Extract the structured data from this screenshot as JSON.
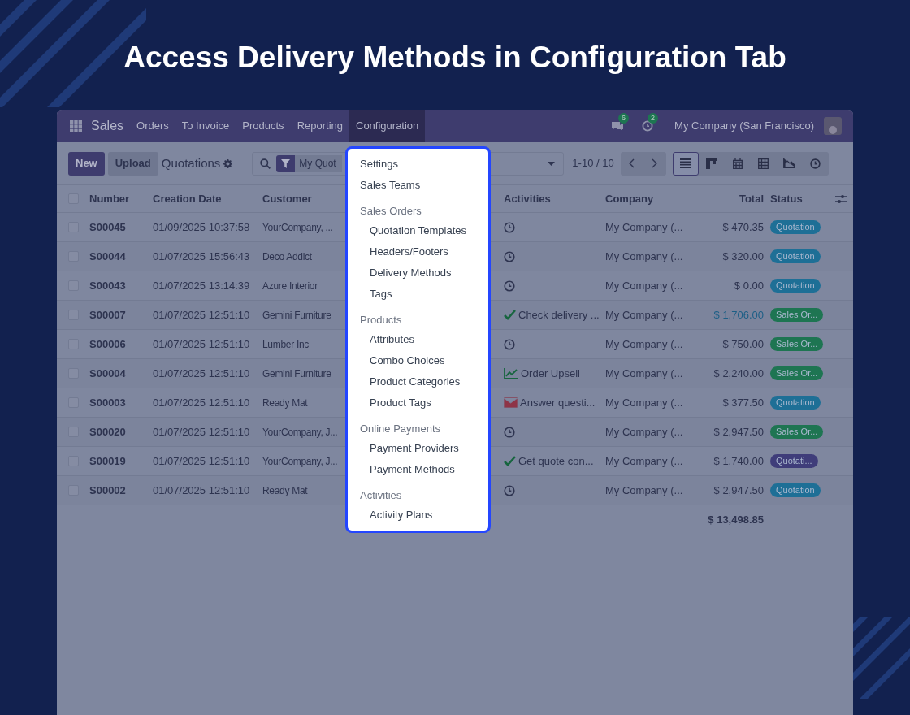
{
  "heading": "Access Delivery Methods in Configuration Tab",
  "navbar": {
    "app": "Sales",
    "items": [
      {
        "label": "Orders",
        "selected": false
      },
      {
        "label": "To Invoice",
        "selected": false
      },
      {
        "label": "Products",
        "selected": false
      },
      {
        "label": "Reporting",
        "selected": false
      },
      {
        "label": "Configuration",
        "selected": true
      }
    ],
    "messages_count": "6",
    "activities_count": "2",
    "company": "My Company (San Francisco)"
  },
  "control_panel": {
    "new": "New",
    "upload": "Upload",
    "title": "Quotations",
    "facet": "My Quot",
    "pager": "1-10 / 10",
    "views": [
      {
        "kind": "list",
        "selected": true
      },
      {
        "kind": "kanban",
        "selected": false
      },
      {
        "kind": "calendar",
        "selected": false
      },
      {
        "kind": "pivot",
        "selected": false
      },
      {
        "kind": "graph",
        "selected": false
      },
      {
        "kind": "activity",
        "selected": false
      }
    ]
  },
  "table": {
    "all_checked": false,
    "columns": [
      "Number",
      "Creation Date",
      "Customer",
      "Activities",
      "Company",
      "Total",
      "Status"
    ],
    "rows": [
      {
        "checked": false,
        "number": "S00045",
        "date": "01/09/2025 10:37:58",
        "customer": "YourCompany, ...",
        "activity": {
          "kind": "clock"
        },
        "company": "My Company (...",
        "total": "$ 470.35",
        "total_highlight": false,
        "status": "Quotation",
        "color": "#1e6f96"
      },
      {
        "checked": false,
        "number": "S00044",
        "date": "01/07/2025 15:56:43",
        "customer": "Deco Addict",
        "activity": {
          "kind": "clock"
        },
        "company": "My Company (...",
        "total": "$ 320.00",
        "total_highlight": false,
        "status": "Quotation",
        "color": "#1e6f96"
      },
      {
        "checked": false,
        "number": "S00043",
        "date": "01/07/2025 13:14:39",
        "customer": "Azure Interior",
        "activity": {
          "kind": "clock"
        },
        "company": "My Company (...",
        "total": "$ 0.00",
        "total_highlight": false,
        "status": "Quotation",
        "color": "#1e6f96"
      },
      {
        "checked": false,
        "number": "S00007",
        "date": "01/07/2025 12:51:10",
        "customer": "Gemini Furniture",
        "activity": {
          "kind": "check",
          "text": "Check delivery ..."
        },
        "company": "My Company (...",
        "total": "$ 1,706.00",
        "total_highlight": true,
        "status": "Sales Or...",
        "color": "#1e7552"
      },
      {
        "checked": false,
        "number": "S00006",
        "date": "01/07/2025 12:51:10",
        "customer": "Lumber Inc",
        "activity": {
          "kind": "clock"
        },
        "company": "My Company (...",
        "total": "$ 750.00",
        "total_highlight": false,
        "status": "Sales Or...",
        "color": "#1e7552"
      },
      {
        "checked": false,
        "number": "S00004",
        "date": "01/07/2025 12:51:10",
        "customer": "Gemini Furniture",
        "activity": {
          "kind": "upsell",
          "text": "Order Upsell"
        },
        "company": "My Company (...",
        "total": "$ 2,240.00",
        "total_highlight": false,
        "status": "Sales Or...",
        "color": "#1e7552"
      },
      {
        "checked": false,
        "number": "S00003",
        "date": "01/07/2025 12:51:10",
        "customer": "Ready Mat",
        "activity": {
          "kind": "mail",
          "text": "Answer questi..."
        },
        "company": "My Company (...",
        "total": "$ 377.50",
        "total_highlight": false,
        "status": "Quotation",
        "color": "#1e6f96"
      },
      {
        "checked": false,
        "number": "S00020",
        "date": "01/07/2025 12:51:10",
        "customer": "YourCompany, J...",
        "activity": {
          "kind": "clock"
        },
        "company": "My Company (...",
        "total": "$ 2,947.50",
        "total_highlight": false,
        "status": "Sales Or...",
        "color": "#1e7552"
      },
      {
        "checked": false,
        "number": "S00019",
        "date": "01/07/2025 12:51:10",
        "customer": "YourCompany, J...",
        "activity": {
          "kind": "check",
          "text": "Get quote con..."
        },
        "company": "My Company (...",
        "total": "$ 1,740.00",
        "total_highlight": false,
        "status": "Quotati...",
        "color": "#3f3d7a"
      },
      {
        "checked": false,
        "number": "S00002",
        "date": "01/07/2025 12:51:10",
        "customer": "Ready Mat",
        "activity": {
          "kind": "clock"
        },
        "company": "My Company (...",
        "total": "$ 2,947.50",
        "total_highlight": false,
        "status": "Quotation",
        "color": "#1e6f96"
      }
    ],
    "sum": "$ 13,498.85"
  },
  "menu": [
    {
      "label": "Settings"
    },
    {
      "label": "Sales Teams"
    },
    {
      "label": "Sales Orders",
      "children": [
        {
          "label": "Quotation Templates"
        },
        {
          "label": "Headers/Footers"
        },
        {
          "label": "Delivery Methods"
        },
        {
          "label": "Tags"
        }
      ]
    },
    {
      "label": "Products",
      "children": [
        {
          "label": "Attributes"
        },
        {
          "label": "Combo Choices"
        },
        {
          "label": "Product Categories"
        },
        {
          "label": "Product Tags"
        }
      ]
    },
    {
      "label": "Online Payments",
      "children": [
        {
          "label": "Payment Providers"
        },
        {
          "label": "Payment Methods"
        }
      ]
    },
    {
      "label": "Activities",
      "children": [
        {
          "label": "Activity Plans"
        }
      ]
    }
  ]
}
